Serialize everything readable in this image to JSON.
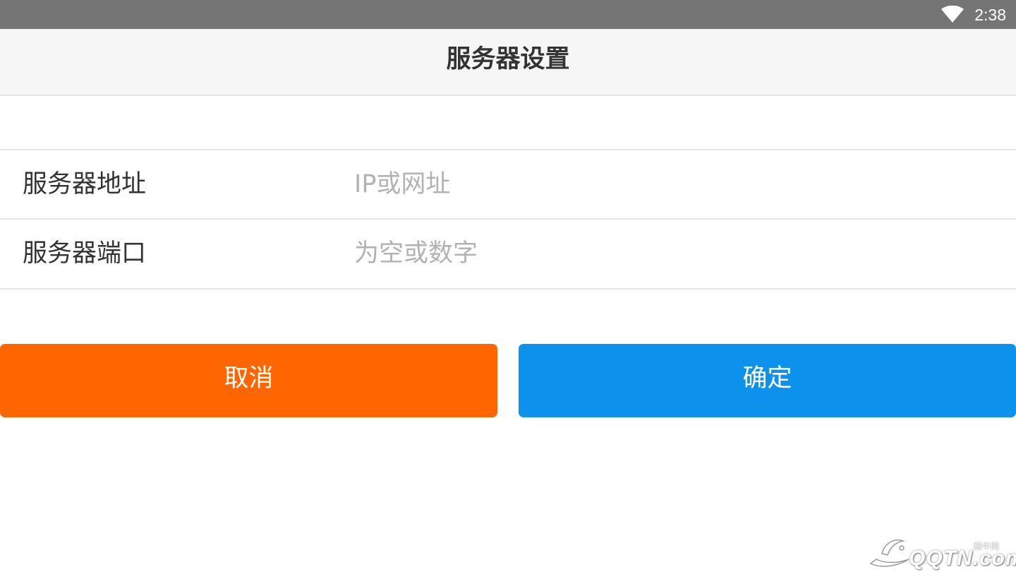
{
  "status_bar": {
    "time": "2:38",
    "wifi_icon": "wifi-icon"
  },
  "header": {
    "title": "服务器设置"
  },
  "form": {
    "address": {
      "label": "服务器地址",
      "value": "",
      "placeholder": "IP或网址"
    },
    "port": {
      "label": "服务器端口",
      "value": "",
      "placeholder": "为空或数字"
    }
  },
  "actions": {
    "cancel_label": "取消",
    "confirm_label": "确定"
  },
  "watermark": {
    "logo_text": "QQTN.com",
    "sub_text": "腾牛网"
  },
  "colors": {
    "status_bar": "#757575",
    "header_bg": "#f6f6f6",
    "cancel": "#ff6600",
    "confirm": "#0c91ec",
    "placeholder": "#b2b2b2",
    "text": "#333333"
  }
}
